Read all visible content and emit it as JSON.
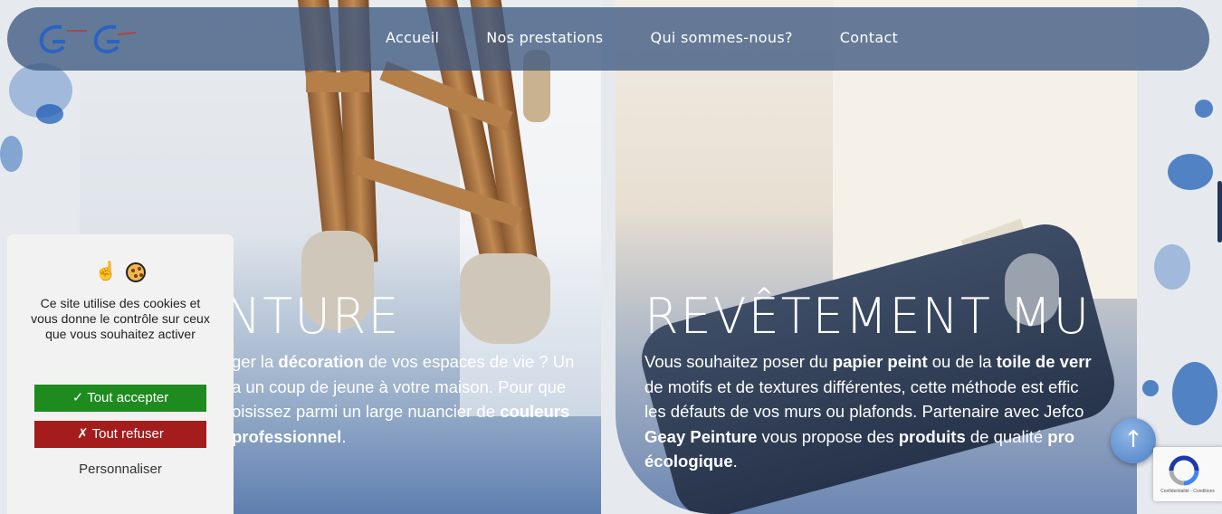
{
  "nav": {
    "items": [
      {
        "label": "Accueil"
      },
      {
        "label": "Nos prestations"
      },
      {
        "label": "Qui sommes-nous?"
      },
      {
        "label": "Contact"
      }
    ]
  },
  "panels": {
    "left": {
      "heading": "NTURE",
      "text": {
        "l1_a": "ger la ",
        "l1_b": "décoration",
        "l1_c": " de vos espaces de vie ? Un",
        "l2": "a un coup de jeune à votre maison. Pour que",
        "l3_a": "oisissez parmi un large nuancier de ",
        "l3_b": "couleurs",
        "l4_a": "professionnel",
        "l4_b": "."
      }
    },
    "right": {
      "heading": "REVÊTEMENT MU",
      "text": {
        "l1_a": "Vous souhaitez poser du ",
        "l1_b": "papier peint",
        "l1_c": " ou de la ",
        "l1_d": "toile de verr",
        "l2": "de motifs et de textures différentes, cette méthode est effic",
        "l3": "les défauts de vos murs ou plafonds. Partenaire avec Jefco",
        "l4_a": "Geay Peinture",
        "l4_b": " vous propose des ",
        "l4_c": "produits",
        "l4_d": " de qualité ",
        "l4_e": "pro",
        "l5_a": "écologique",
        "l5_b": "."
      }
    }
  },
  "cookie": {
    "icons": [
      "hand-pointing-up-icon",
      "cookie-icon"
    ],
    "message": "Ce site utilise des cookies et vous donne le contrôle sur ceux que vous souhaitez activer",
    "accept_label": "✓ Tout accepter",
    "refuse_label": "✗ Tout refuser",
    "customize_label": "Personnaliser"
  },
  "back_to_top": {
    "icon": "arrow-up-icon",
    "glyph": "↑"
  },
  "recaptcha": {
    "text": "Confidentialité - Conditions"
  },
  "colors": {
    "nav_bg": "#3e5880",
    "accept": "#1e8b1e",
    "refuse": "#a41c1c",
    "accent_blue": "#1f5fb4"
  }
}
